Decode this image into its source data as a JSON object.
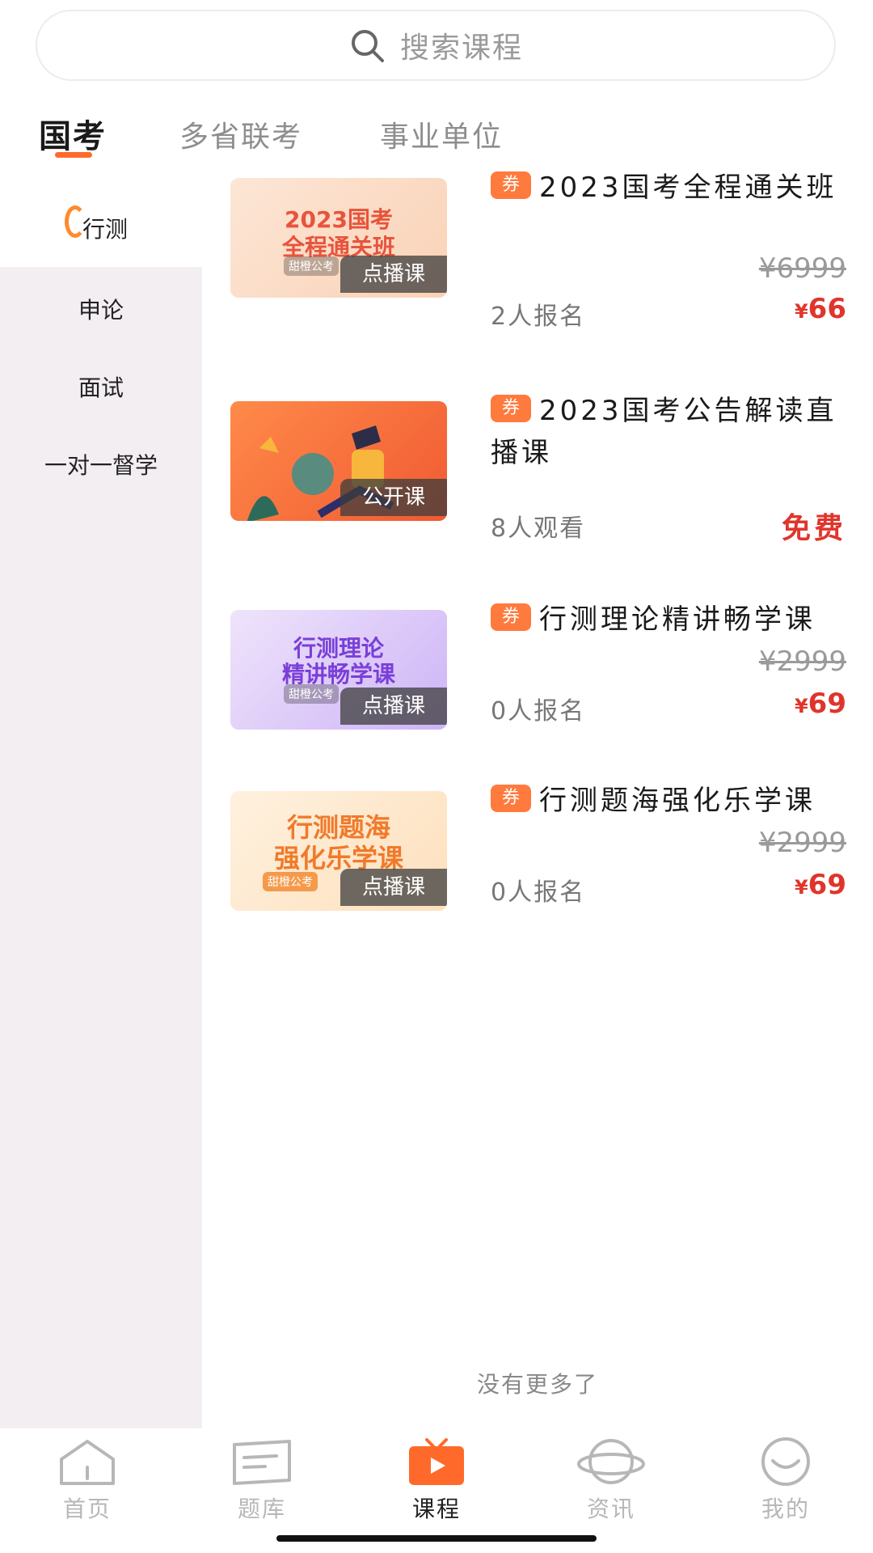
{
  "search": {
    "placeholder": "搜索课程"
  },
  "top_tabs": [
    {
      "label": "国考",
      "active": true
    },
    {
      "label": "多省联考",
      "active": false
    },
    {
      "label": "事业单位",
      "active": false
    }
  ],
  "sidebar": {
    "items": [
      {
        "label": "行测",
        "active": true
      },
      {
        "label": "申论",
        "active": false
      },
      {
        "label": "面试",
        "active": false
      },
      {
        "label": "一对一督学",
        "active": false
      }
    ]
  },
  "courses": [
    {
      "coupon": "券",
      "title": "2023国考全程通关班",
      "thumb_title_1": "2023国考",
      "thumb_title_2": "全程通关班",
      "thumb_brand": "甜橙公考",
      "badge": "点播课",
      "original_price": "¥6999",
      "meta": "2人报名",
      "price_symbol": "¥",
      "price": "66"
    },
    {
      "coupon": "券",
      "title": "2023国考公告解读直播课",
      "badge": "公开课",
      "meta": "8人观看",
      "free": "免费"
    },
    {
      "coupon": "券",
      "title": "行测理论精讲畅学课",
      "thumb_title_1": "行测理论",
      "thumb_title_2": "精讲畅学课",
      "thumb_brand": "甜橙公考",
      "badge": "点播课",
      "original_price": "¥2999",
      "meta": "0人报名",
      "price_symbol": "¥",
      "price": "69"
    },
    {
      "coupon": "券",
      "title": "行测题海强化乐学课",
      "thumb_title_1": "行测题海",
      "thumb_title_2": "强化乐学课",
      "thumb_brand": "甜橙公考",
      "badge": "点播课",
      "original_price": "¥2999",
      "meta": "0人报名",
      "price_symbol": "¥",
      "price": "69"
    }
  ],
  "no_more": "没有更多了",
  "bottom_nav": [
    {
      "label": "首页",
      "icon": "home-icon",
      "active": false
    },
    {
      "label": "题库",
      "icon": "book-icon",
      "active": false
    },
    {
      "label": "课程",
      "icon": "video-icon",
      "active": true
    },
    {
      "label": "资讯",
      "icon": "planet-icon",
      "active": false
    },
    {
      "label": "我的",
      "icon": "smile-icon",
      "active": false
    }
  ],
  "colors": {
    "accent": "#ff6a2a",
    "price": "#e0352b",
    "sidebar_bg": "#f3eef2",
    "coupon": "#ff7a3d"
  }
}
